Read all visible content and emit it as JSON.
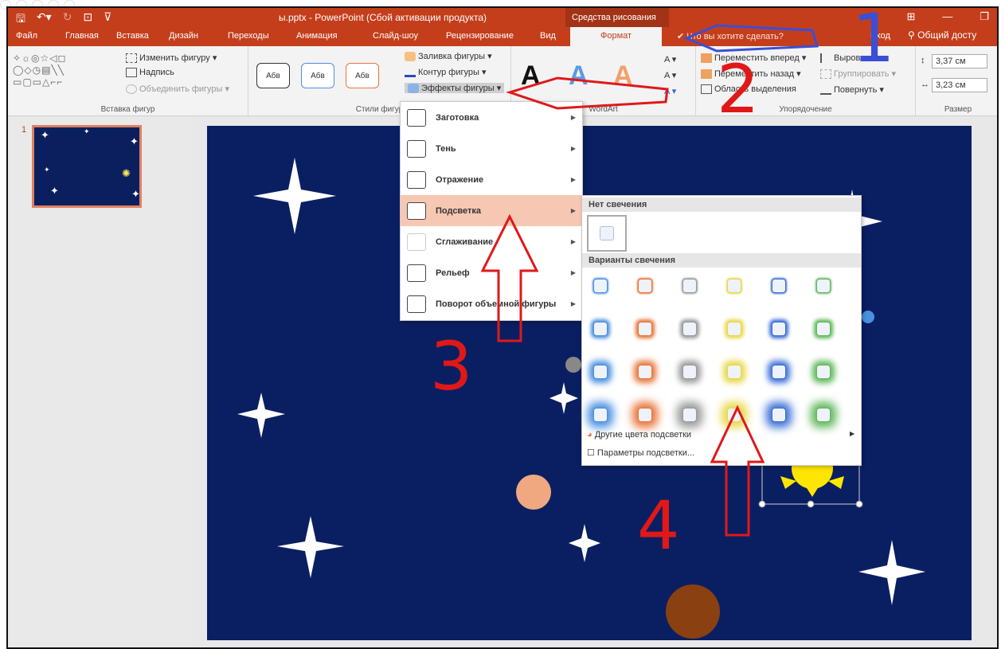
{
  "title_bar": {
    "document_title": "ы.pptx - PowerPoint (Сбой активации продукта)",
    "context_group": "Средства рисования"
  },
  "tabs": [
    {
      "label": "Файл"
    },
    {
      "label": "Главная"
    },
    {
      "label": "Вставка"
    },
    {
      "label": "Дизайн"
    },
    {
      "label": "Переходы"
    },
    {
      "label": "Анимация"
    },
    {
      "label": "Слайд-шоу"
    },
    {
      "label": "Рецензирование"
    },
    {
      "label": "Вид"
    },
    {
      "label": "Формат",
      "active": true
    }
  ],
  "tell_me": "Что вы хотите сделать?",
  "account": {
    "signin": "Вход",
    "share": "Общий досту"
  },
  "ribbon": {
    "insert_shapes": {
      "edit_shape": "Изменить фигуру",
      "textbox": "Надпись",
      "merge": "Объединить фигуры",
      "label": "Вставка фигур"
    },
    "shape_styles": {
      "samples": [
        "Абв",
        "Абв",
        "Абв"
      ],
      "fill": "Заливка фигуры",
      "outline": "Контур фигуры",
      "effects": "Эффекты фигуры",
      "label": "Стили фигур"
    },
    "wordart": {
      "label": "WordArt",
      "letters": [
        "A",
        "A",
        "A"
      ]
    },
    "arrange": {
      "bring_forward": "Переместить вперед",
      "send_backward": "Переместить назад",
      "selection_pane": "Область выделения",
      "align": "Выровнять",
      "group": "Группировать",
      "rotate": "Повернуть",
      "label": "Упорядочение"
    },
    "size": {
      "height": "3,37 см",
      "width": "3,23 см",
      "label": "Размер"
    }
  },
  "slide_pane": {
    "slide_number": "1"
  },
  "effects_menu": [
    {
      "label": "Заготовка"
    },
    {
      "label": "Тень"
    },
    {
      "label": "Отражение"
    },
    {
      "label": "Подсветка",
      "highlighted": true
    },
    {
      "label": "Сглаживание"
    },
    {
      "label": "Рельеф"
    },
    {
      "label": "Поворот объемной фигуры"
    }
  ],
  "glow_submenu": {
    "no_glow_header": "Нет свечения",
    "variants_header": "Варианты свечения",
    "variant_colors": [
      "#4a8fe0",
      "#e8763a",
      "#9a9a9a",
      "#e8d84a",
      "#3c6fd6",
      "#5fb85a"
    ],
    "variant_rows": 4,
    "more_colors": "Другие цвета подсветки",
    "options": "Параметры подсветки..."
  },
  "annotations": {
    "numbers": [
      "1",
      "2",
      "3",
      "4"
    ],
    "colors": {
      "blue": "#3a4fd6",
      "red": "#e01818"
    }
  },
  "colors": {
    "accent": "#c43e1c",
    "slide_background": "#0a1f62"
  }
}
